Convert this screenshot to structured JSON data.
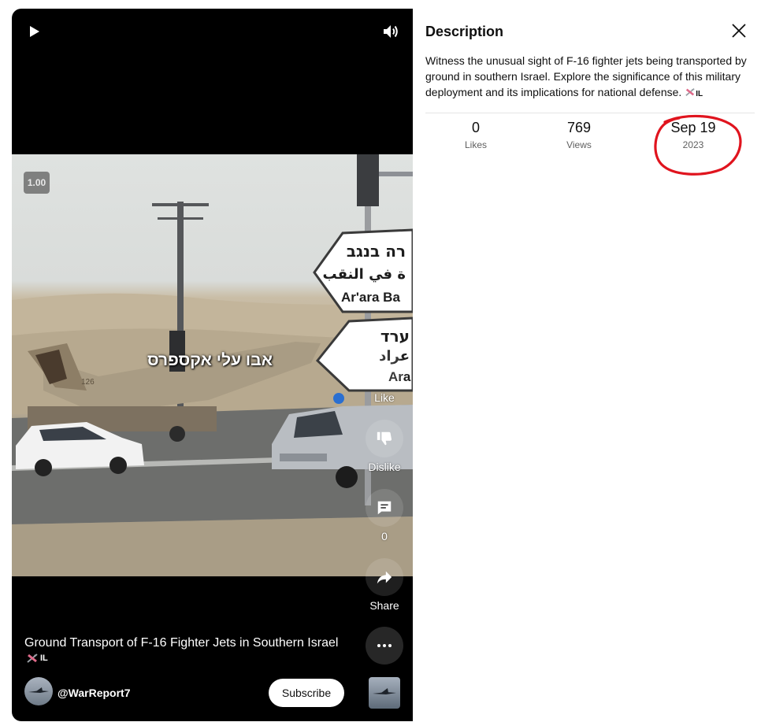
{
  "player": {
    "speed": "1.00",
    "overlay_caption": "אבו עלי אקספרס",
    "sign_texts": {
      "sign1_top": "רה בנגב",
      "sign1_arabic": "ة في النقب",
      "sign1_latin": "Ar'ara Ba",
      "sign2_top": "ערד",
      "sign2_arabic": "عراد",
      "sign2_latin": "Ara"
    },
    "jet_number": "126",
    "actions": {
      "like_label": "Like",
      "dislike_label": "Dislike",
      "comments_count": "0",
      "share_label": "Share"
    },
    "video_title": "Ground Transport of F-16 Fighter Jets in Southern Israel",
    "title_flag": "IL",
    "channel_handle": "@WarReport7",
    "subscribe_label": "Subscribe"
  },
  "description": {
    "heading": "Description",
    "text": "Witness the unusual sight of F-16 fighter jets being transported by ground in southern Israel. Explore the significance of this military deployment and its implications for national defense.",
    "flag": "IL",
    "stats": {
      "likes_value": "0",
      "likes_label": "Likes",
      "views_value": "769",
      "views_label": "Views",
      "date_value": "Sep 19",
      "date_year": "2023"
    }
  },
  "colors": {
    "annotation_circle": "#e0141e",
    "player_bg": "#000000",
    "panel_bg": "#ffffff",
    "secondary_text": "#606060"
  }
}
